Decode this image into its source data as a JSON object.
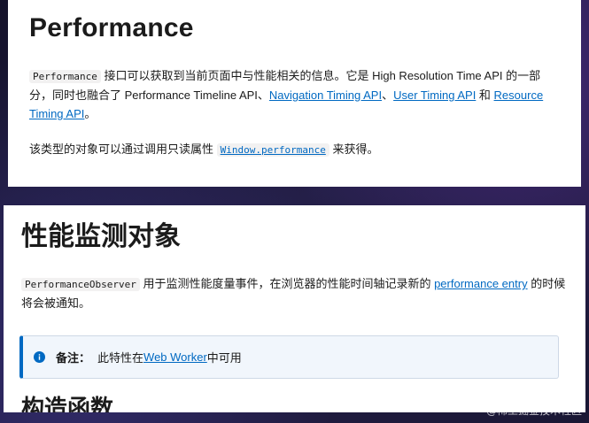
{
  "top_panel": {
    "title": "Performance",
    "p1": {
      "code_performance": "Performance",
      "text_1": " 接口可以获取到当前页面中与性能相关的信息。它是 High Resolution Time API 的一部分，同时也融合了 Performance Timeline API、",
      "link_navigation": "Navigation Timing API",
      "text_2": "、",
      "link_user_timing": "User Timing API",
      "text_3": " 和 ",
      "link_resource_timing": "Resource Timing API",
      "text_4": "。"
    },
    "p2": {
      "text_1": "该类型的对象可以通过调用只读属性 ",
      "code_window_performance": "Window.performance",
      "text_2": " 来获得。"
    }
  },
  "bottom_panel": {
    "heading": "性能监测对象",
    "p1": {
      "code_observer": "PerformanceObserver",
      "text_1": " 用于监测性能度量事件，在浏览器的性能时间轴记录新的 ",
      "link_performance_entry": "performance entry",
      "text_2": " 的时候将会被通知。"
    },
    "note": {
      "icon": "info-icon",
      "label": "备注：",
      "text_1": "此特性在 ",
      "link_web_worker": "Web Worker",
      "text_2": " 中可用"
    },
    "cut_heading": "构造函数"
  },
  "watermark": "@稀土掘金技术社区"
}
